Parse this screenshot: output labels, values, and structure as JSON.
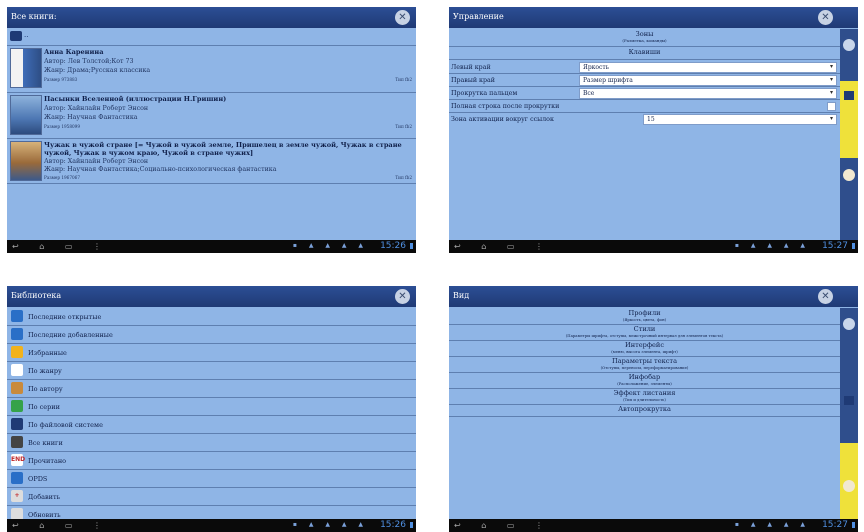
{
  "clock1": "15:26",
  "clock2": "15:27",
  "clock3": "15:26",
  "clock4": "15:27",
  "p1": {
    "title": "Все книги:",
    "updir": "..",
    "books": [
      {
        "title": "Анна Каренина",
        "author": "Автор: Лев Толстой;Кот 73",
        "genre": "Жанр: Драма;Русская классика",
        "size": "Размер 973883",
        "type": "Тип fb2"
      },
      {
        "title": "Пасынки Вселенной (иллюстрации Н.Гришин)",
        "author": "Автор: Хайнлайн Роберт Энсон",
        "genre": "Жанр: Научная Фантастика",
        "size": "Размер 1958099",
        "type": "Тип fb2"
      },
      {
        "title": "Чужак в чужой стране [= Чужой в чужой земле, Пришелец в земле чужой, Чужак в стране чужой, Чужак в чужом краю, Чужой в стране чужих]",
        "author": "Автор: Хайнлайн Роберт Энсон",
        "genre": "Жанр: Научная Фантастика;Социально-психологическая фантастика",
        "size": "Размер 1967067",
        "type": "Тип fb2"
      }
    ]
  },
  "p2": {
    "title": "Управление",
    "zones": "Зоны",
    "zones_sub": "(Разметка, команды)",
    "keys": "Клавиши",
    "rows": [
      {
        "label": "Левый край",
        "value": "Яркость"
      },
      {
        "label": "Правый край",
        "value": "Размер шрифта"
      },
      {
        "label": "Прокрутка пальцем",
        "value": "Все"
      }
    ],
    "fullline": "Полная строка после прокрутки",
    "zone_label": "Зона активации вокруг ссылок",
    "zone_value": "15"
  },
  "p3": {
    "title": "Библиотека",
    "items": [
      {
        "label": "Последние открытые",
        "icon": "globe-icon",
        "color": "#2a6fc7"
      },
      {
        "label": "Последние добавленные",
        "icon": "globe-icon",
        "color": "#2a6fc7"
      },
      {
        "label": "Избранные",
        "icon": "star-icon",
        "color": "#f2b21b"
      },
      {
        "label": "По жанру",
        "icon": "genre-icon",
        "color": "#ffffff"
      },
      {
        "label": "По автору",
        "icon": "author-icon",
        "color": "#c98a3c"
      },
      {
        "label": "По серии",
        "icon": "flag-icon",
        "color": "#35a24a"
      },
      {
        "label": "По файловой системе",
        "icon": "folder-icon",
        "color": "#1f3a75"
      },
      {
        "label": "Все книги",
        "icon": "books-icon",
        "color": "#444444"
      },
      {
        "label": "Прочитано",
        "icon": "end-icon",
        "color": "#ffffff",
        "glyph": "END"
      },
      {
        "label": "OPDS",
        "icon": "opds-icon",
        "color": "#2a6fc7"
      },
      {
        "label": "Добавить",
        "icon": "add-icon",
        "color": "#dddddd",
        "glyph": "+"
      },
      {
        "label": "Обновить",
        "icon": "refresh-icon",
        "color": "#dddddd"
      }
    ]
  },
  "p4": {
    "title": "Вид",
    "sections": [
      {
        "h": "Профили",
        "s": "(Яркость, цвета, фон)"
      },
      {
        "h": "Стили",
        "s": "(Параметры шрифта, отступы, межстрочный интервал для элементов текста)"
      },
      {
        "h": "Интерфейс",
        "s": "(меню, высота элемента, шрифт)"
      },
      {
        "h": "Параметры текста",
        "s": "(Отступы, переносы, переформатирование)"
      },
      {
        "h": "Инфобар",
        "s": "(Расположение, элементы)"
      },
      {
        "h": "Эффект листания",
        "s": "(Тип и длительность)"
      },
      {
        "h": "Автопрокрутка",
        "s": ""
      }
    ]
  }
}
